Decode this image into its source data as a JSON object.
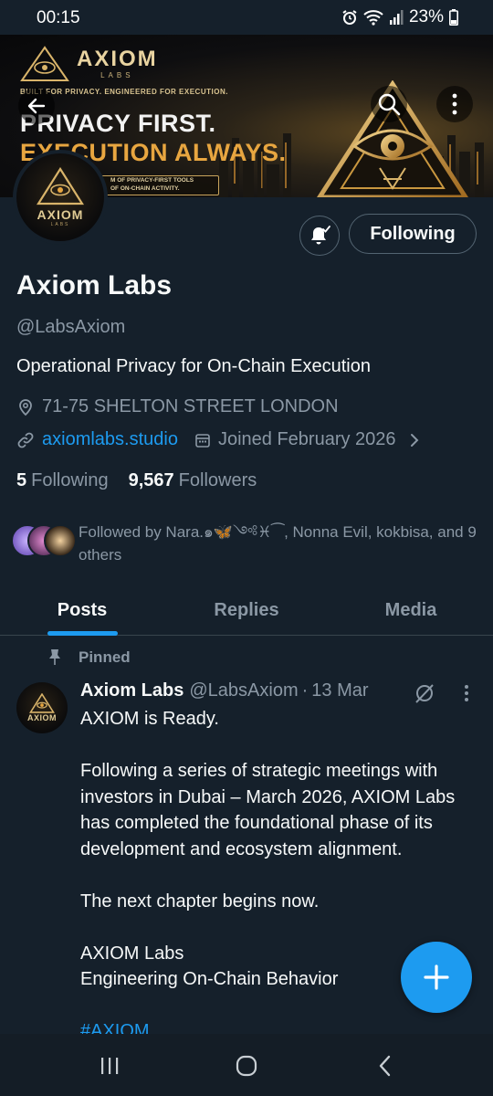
{
  "status_bar": {
    "time": "00:15",
    "battery": "23%",
    "icons": [
      "alarm-icon",
      "wifi-icon",
      "signal-icon",
      "battery-icon"
    ]
  },
  "banner": {
    "logo_name": "AXIOM",
    "logo_sub": "LABS",
    "tagline": "BUILT FOR PRIVACY. ENGINEERED FOR EXECUTION.",
    "headline_1": "PRIVACY FIRST.",
    "headline_2": "EXECUTION ALWAYS.",
    "cta_line_1": "M OF PRIVACY-FIRST TOOLS",
    "cta_line_2": "OF ON-CHAIN ACTIVITY."
  },
  "header_actions": {
    "back_icon": "arrow-left-icon",
    "search_icon": "search-icon",
    "more_icon": "more-vertical-icon"
  },
  "profile": {
    "avatar_name": "AXIOM",
    "avatar_sub": "LABS",
    "name": "Axiom Labs",
    "handle": "@LabsAxiom",
    "bio": "Operational Privacy for On-Chain Execution",
    "location": "71-75 SHELTON STREET LONDON",
    "website": "axiomlabs.studio",
    "joined": "Joined February 2026",
    "following_count": "5",
    "following_label": "Following",
    "followers_count": "9,567",
    "followers_label": "Followers",
    "follow_button": "Following",
    "followed_by": "Followed by Nara.๑🦋༺♓︎⁀, Nonna Evil, kokbisa, and 9 others"
  },
  "tabs": [
    {
      "label": "Posts",
      "active": true
    },
    {
      "label": "Replies",
      "active": false
    },
    {
      "label": "Media",
      "active": false
    }
  ],
  "post": {
    "pinned_label": "Pinned",
    "avatar_name": "AXIOM",
    "author": "Axiom Labs",
    "handle": "@LabsAxiom",
    "separator": "·",
    "date": "13 Mar",
    "paragraphs": [
      "AXIOM is Ready.",
      "Following a series of strategic meetings with investors in Dubai – March 2026, AXIOM Labs has completed the foundational phase of its development and ecosystem alignment.",
      "The next chapter begins now.",
      "AXIOM Labs",
      "Engineering On-Chain Behavior"
    ],
    "hashtag": "#AXIOM"
  },
  "colors": {
    "background": "#15202b",
    "accent": "#1d9bf0",
    "muted": "#8b98a5",
    "border": "#536471",
    "gold": "#e8a640"
  }
}
